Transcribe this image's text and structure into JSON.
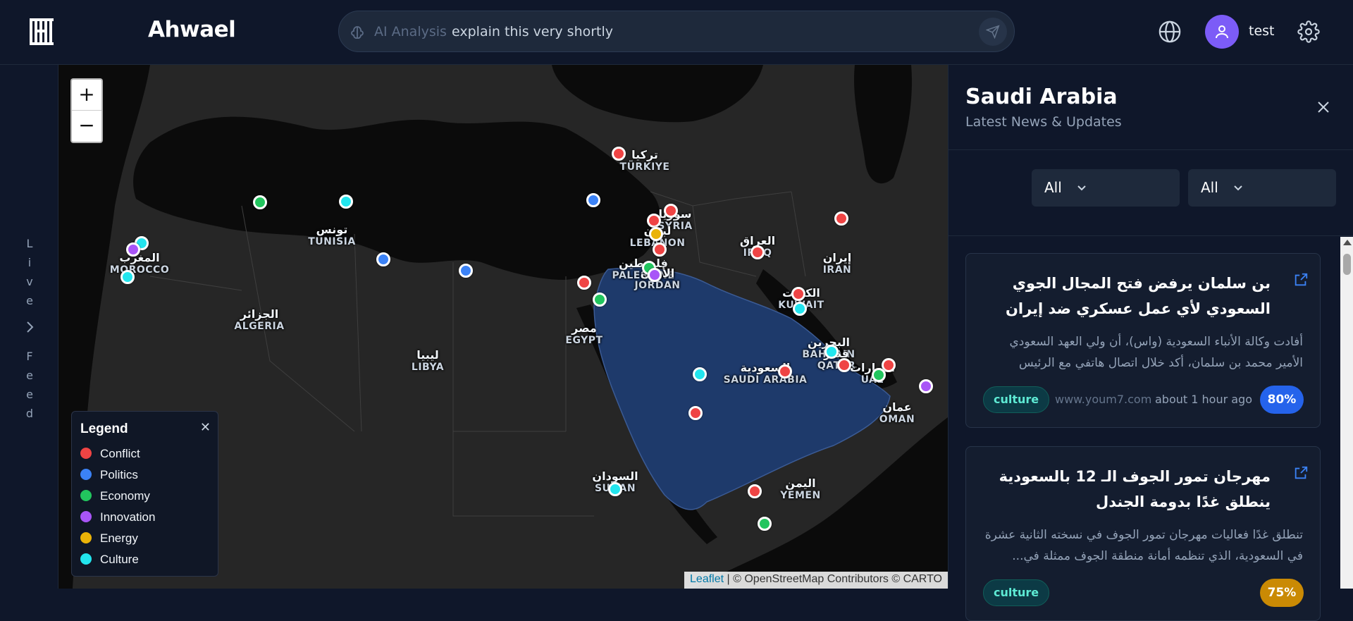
{
  "app": {
    "title": "Ahwael",
    "user_name": "test"
  },
  "search": {
    "label": "AI Analysis",
    "value": "explain this very shortly"
  },
  "live_feed": {
    "label_top": "Live",
    "label_bottom": "Feed"
  },
  "map": {
    "zoom_in": "+",
    "zoom_out": "−",
    "attribution_leaflet": "Leaflet",
    "attribution_rest": " | © OpenStreetMap Contributors © CARTO",
    "countries": [
      {
        "ar": "تركيا",
        "en": "TÜRKIYE"
      },
      {
        "ar": "سوريا",
        "en": "SYRIA"
      },
      {
        "ar": "لبنان",
        "en": "LEBANON"
      },
      {
        "ar": "فلسطين",
        "en": "PALESTINE"
      },
      {
        "ar": "الأردن",
        "en": "JORDAN"
      },
      {
        "ar": "العراق",
        "en": "IRAQ"
      },
      {
        "ar": "إيران",
        "en": "IRAN"
      },
      {
        "ar": "الكويت",
        "en": "KUWAIT"
      },
      {
        "ar": "البحرين",
        "en": "BAHRAIN"
      },
      {
        "ar": "قطر",
        "en": "QATAR"
      },
      {
        "ar": "الإمارات",
        "en": "UAE"
      },
      {
        "ar": "عمان",
        "en": "OMAN"
      },
      {
        "ar": "السعودية",
        "en": "SAUDI ARABIA"
      },
      {
        "ar": "اليمن",
        "en": "YEMEN"
      },
      {
        "ar": "مصر",
        "en": "EGYPT"
      },
      {
        "ar": "السودان",
        "en": "SUDAN"
      },
      {
        "ar": "ليبيا",
        "en": "LIBYA"
      },
      {
        "ar": "تونس",
        "en": "TUNISIA"
      },
      {
        "ar": "الجزائر",
        "en": "ALGERIA"
      },
      {
        "ar": "المغرب",
        "en": "MOROCCO"
      }
    ],
    "legend": {
      "title": "Legend",
      "close": "✕",
      "items": [
        {
          "label": "Conflict",
          "color": "#ef4444"
        },
        {
          "label": "Politics",
          "color": "#3b82f6"
        },
        {
          "label": "Economy",
          "color": "#22c55e"
        },
        {
          "label": "Innovation",
          "color": "#a855f7"
        },
        {
          "label": "Energy",
          "color": "#eab308"
        },
        {
          "label": "Culture",
          "color": "#22e5ee"
        }
      ]
    }
  },
  "panel": {
    "title": "Saudi Arabia",
    "subtitle": "Latest News & Updates",
    "filter_1": "All",
    "filter_2": "All",
    "cards": [
      {
        "title": "بن سلمان يرفض فتح المجال الجوي السعودي لأي عمل عسكري ضد إيران",
        "body": "أفادت وكالة الأنباء السعودية (واس)، أن ولي العهد السعودي الأمير محمد بن سلمان، أكد خلال اتصال هاتفي مع الرئيس الإيراني...",
        "tag": "culture",
        "source": "www.youm7.com",
        "time": "about 1 hour ago",
        "score": "80%"
      },
      {
        "title": "مهرجان تمور الجوف الـ 12 بالسعودية ينطلق غدًا بدومة الجندل",
        "body": "تنطلق غدًا فعاليات مهرجان تمور الجوف في نسخته الثانية عشرة في السعودية، الذي تنظمه أمانة منطقة الجوف ممثلة في...",
        "tag": "culture",
        "source": "",
        "time": "",
        "score": "75%"
      }
    ]
  }
}
